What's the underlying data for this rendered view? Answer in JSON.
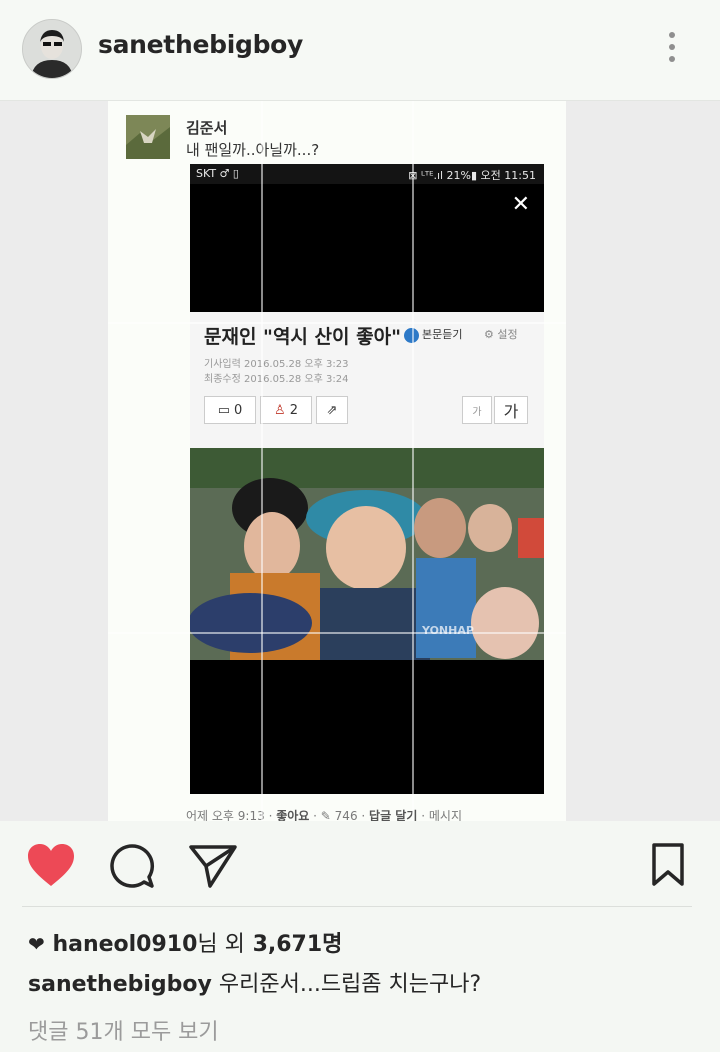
{
  "header": {
    "username": "sanethebigboy",
    "avatar_icon": "profile-avatar",
    "menu_icon": "more-vertical-icon"
  },
  "post_image": {
    "comment": {
      "author": "김준서",
      "text": "내 팬일까..아닐까...?"
    },
    "phone": {
      "carrier": "SKT ♂ ▯",
      "status_right": "⊠ ᴸᵀᴱ.ıl 21%▮ 오전 11:51",
      "close": "✕",
      "article": {
        "title": "문재인 \"역시 산이 좋아\"",
        "listen_label": "본문듣기",
        "settings_label": "⚙ 설정",
        "published": "기사입력  2016.05.28 오후 3:23",
        "modified": "최종수정  2016.05.28 오후 3:24",
        "comment_count": "0",
        "like_count": "2",
        "font_small": "가",
        "font_large": "가"
      },
      "photo_watermark": "YONHAP"
    },
    "comment_footer": {
      "time": "어제 오후 9:13",
      "like": "좋아요",
      "like_count": "746",
      "reply": "답글 달기",
      "message": "메시지"
    }
  },
  "actions": {
    "like_icon": "heart-icon",
    "comment_icon": "comment-icon",
    "share_icon": "send-icon",
    "save_icon": "bookmark-icon",
    "like_color": "#ed4956"
  },
  "likes": {
    "first_user": "haneol0910",
    "suffix": "님 외",
    "count": "3,671",
    "unit": "명"
  },
  "caption": {
    "user": "sanethebigboy",
    "text": "우리준서...드립좀 치는구나?"
  },
  "view_comments": "댓글 51개 모두 보기"
}
